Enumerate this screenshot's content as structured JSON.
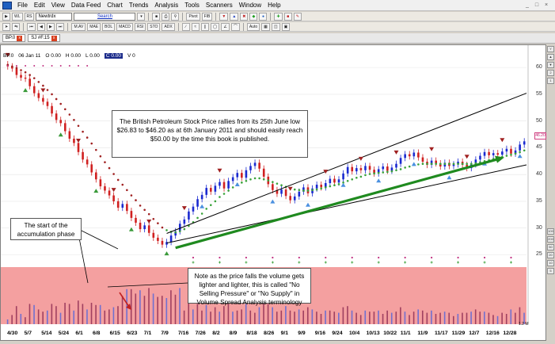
{
  "menu": [
    "File",
    "Edit",
    "View",
    "Data Feed",
    "Chart",
    "Trends",
    "Analysis",
    "Tools",
    "Scanners",
    "Window",
    "Help"
  ],
  "window_controls": [
    "_",
    "□",
    "×"
  ],
  "toolbar1": {
    "btn_a": "WL",
    "btn_b": "RS",
    "symbol_value": "Newtrdx",
    "search_label": "Search",
    "pivot_label": "Pivot",
    "fib_label": "FIB"
  },
  "toolbar2": {
    "buttons": [
      "M.AV",
      "MAE",
      "BOL",
      "MACD",
      "RSI",
      "STO",
      "ADX"
    ],
    "auto_label": "Auto"
  },
  "tabs": [
    {
      "label": "BP.0"
    },
    {
      "label": "SJ #F.15"
    }
  ],
  "price_header": {
    "symbol": "BP.0",
    "date": "06 Jan 11",
    "open": "O 0.00",
    "high": "H 0.00",
    "low": "L 0.00",
    "close": "C 0.00",
    "volume": "V 0"
  },
  "current_price_tag": "46.20",
  "right_panel_buttons": [
    "Y",
    "▲",
    "▼",
    "2",
    "1",
    "100",
    "200",
    "50",
    "20",
    "10",
    "5"
  ],
  "annotations": {
    "main": "The British Petroleum Stock Price rallies from its 25th June low $26.83 to $46.20 as at 6th January 2011 and should easily reach $50.00 by the time this book is published.",
    "accumulation": "The start of the accumulation phase",
    "volume": "Note as the price falls the volume gets lighter and lighter, this is called \"No Selling Pressure\" or \"No Supply\" in Volume Spread Analysis terminology"
  },
  "date_labels": [
    "4/30",
    "5/7",
    "5/14",
    "5/24",
    "6/1",
    "6/8",
    "6/15",
    "6/23",
    "7/1",
    "7/9",
    "7/16",
    "7/26",
    "8/2",
    "8/9",
    "8/18",
    "8/26",
    "9/1",
    "9/9",
    "9/16",
    "9/24",
    "10/4",
    "10/13",
    "10/22",
    "11/1",
    "11/9",
    "11/17",
    "11/29",
    "12/7",
    "12/16",
    "12/28"
  ],
  "volume_axis_label": "1.2 M",
  "chart_data": {
    "type": "candlestick",
    "y_ticks": [
      25,
      30,
      35,
      40,
      45,
      50,
      55,
      60
    ],
    "ylim": [
      23,
      61.5
    ],
    "x_labels": [
      "4/30",
      "5/7",
      "5/14",
      "5/24",
      "6/1",
      "6/8",
      "6/15",
      "6/23",
      "7/1",
      "7/9",
      "7/16",
      "7/26",
      "8/2",
      "8/9",
      "8/18",
      "8/26",
      "9/1",
      "9/9",
      "9/16",
      "9/24",
      "10/4",
      "10/13",
      "10/22",
      "11/1",
      "11/9",
      "11/17",
      "11/29",
      "12/7",
      "12/16",
      "12/28"
    ],
    "close": [
      60.2,
      59.8,
      58.6,
      58.1,
      57.9,
      56.5,
      55.2,
      54.3,
      53.6,
      52.8,
      51.4,
      50.2,
      49.6,
      48.1,
      46.7,
      45.9,
      44.2,
      42.8,
      41.9,
      40.4,
      39.1,
      37.8,
      37.0,
      36.1,
      35.0,
      33.8,
      34.5,
      33.2,
      31.9,
      31.0,
      29.8,
      30.5,
      29.1,
      28.2,
      27.6,
      26.9,
      27.4,
      28.6,
      29.4,
      30.8,
      31.6,
      33.1,
      34.0,
      35.4,
      36.2,
      37.5,
      36.8,
      37.9,
      38.6,
      37.4,
      38.8,
      39.5,
      40.3,
      39.4,
      40.8,
      41.6,
      42.2,
      41.1,
      39.6,
      38.2,
      37.1,
      36.4,
      37.2,
      36.0,
      35.2,
      35.9,
      36.8,
      37.6,
      36.5,
      37.4,
      38.1,
      37.6,
      38.4,
      39.2,
      38.5,
      39.1,
      40.2,
      41.4,
      40.6,
      41.2,
      40.8,
      41.6,
      40.9,
      40.2,
      41.0,
      41.5,
      40.7,
      41.3,
      42.0,
      43.1,
      43.8,
      43.4,
      44.1,
      43.2,
      42.4,
      41.8,
      42.6,
      42.1,
      41.5,
      42.2,
      41.6,
      41.9,
      42.4,
      41.8,
      41.2,
      41.9,
      42.8,
      43.5,
      44.2,
      43.6,
      44.0,
      43.7,
      44.3,
      44.8,
      43.9,
      44.5,
      45.6,
      46.2
    ],
    "moving_average": [
      60.5,
      60.2,
      59.9,
      59.5,
      59.1,
      58.6,
      58.0,
      57.3,
      56.6,
      55.8,
      55.0,
      54.1,
      53.2,
      52.2,
      51.2,
      50.2,
      49.1,
      48.0,
      46.9,
      45.8,
      44.6,
      43.4,
      42.3,
      41.2,
      40.1,
      39.0,
      38.1,
      37.1,
      36.1,
      35.2,
      34.2,
      33.4,
      32.6,
      31.7,
      30.9,
      30.1,
      29.6,
      29.3,
      29.2,
      29.4,
      29.8,
      30.4,
      31.1,
      31.9,
      32.7,
      33.6,
      34.3,
      35.0,
      35.8,
      36.4,
      37.0,
      37.6,
      38.2,
      38.5,
      38.8,
      39.1,
      39.3,
      39.3,
      39.1,
      38.9,
      38.6,
      38.3,
      38.0,
      37.7,
      37.4,
      37.2,
      37.1,
      37.0,
      37.0,
      37.1,
      37.2,
      37.4,
      37.6,
      37.8,
      38.0,
      38.2,
      38.5,
      38.8,
      39.1,
      39.4,
      39.6,
      39.9,
      40.1,
      40.2,
      40.3,
      40.4,
      40.5,
      40.6,
      40.8,
      41.0,
      41.3,
      41.5,
      41.8,
      41.9,
      42.0,
      42.0,
      42.0,
      42.0,
      42.0,
      42.0,
      42.0,
      42.0,
      42.0,
      42.0,
      42.0,
      42.0,
      42.1,
      42.3,
      42.5,
      42.7,
      42.9,
      43.1,
      43.3,
      43.5,
      43.7,
      43.9,
      44.2,
      44.5
    ],
    "trend_channel": {
      "upper": [
        [
          29.0,
          55.2
        ]
      ],
      "lower": [
        [
          27.2,
          41.8
        ]
      ]
    },
    "volume_ylim": [
      0,
      1.2
    ]
  },
  "colors": {
    "volume_bg": "#f4a0a0",
    "ma_color": "#3aa33a",
    "bull_candle": "#1a2ad0",
    "bear_candle": "#d02020",
    "trend_arrow": "#1f8a1f",
    "bear_marker": "#a02020",
    "bull_marker": "#4a90e0",
    "green_marker": "#3a9a3a"
  }
}
